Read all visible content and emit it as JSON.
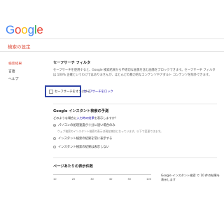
{
  "logo": {
    "letters": [
      "G",
      "o",
      "o",
      "g",
      "l",
      "e"
    ]
  },
  "page_title": "検索の設定",
  "sidebar": {
    "items": [
      {
        "label": "検索結果"
      },
      {
        "label": "言語"
      },
      {
        "label": "ヘルプ"
      }
    ]
  },
  "safesearch": {
    "title": "セーフサーチ フィルタ",
    "description": "セーフサーチを使用すると、Google 検索結果から不適切な画像を含む画像をブロックできます。セーフサーチ フィルタは 100% 正確というわけではありませんが、ほとんどの暴力的なコンテンツやアダルト コンテンツを除外できます。",
    "checkbox_label": "セーフサーチをオンにする",
    "lock_link": "セーフサーチをロック"
  },
  "instant": {
    "title": "Google インスタント検索の予測",
    "hint_prefix": "どのような場合に",
    "hint_link": "入力時の結果",
    "hint_suffix": "を表示しますか？",
    "options": [
      {
        "label": "パソコンの処理速度が十分に速い場合のみ",
        "checked": true
      },
      {
        "label": "インスタント検索の結果を常に表示する",
        "checked": false
      },
      {
        "label": "インスタント検索の結果は表示しない",
        "checked": false
      }
    ],
    "option1_desc": "ウェブ検索のインスタント検索の表示は現在無効になっています。以下で変更できます。"
  },
  "results_per_page": {
    "title": "ページあたりの表示件数",
    "ticks": [
      "10",
      "20",
      "30",
      "40",
      "50",
      "100"
    ],
    "note": "Google インスタント検索 で 10 件の結果を表示します"
  }
}
